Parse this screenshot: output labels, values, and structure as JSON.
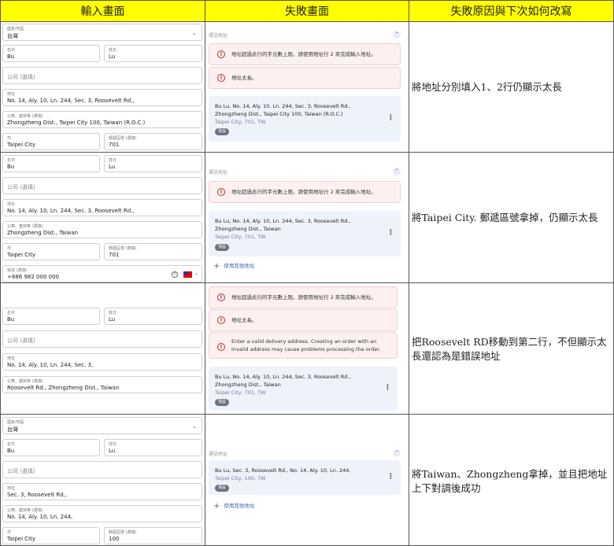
{
  "headers": {
    "input": "輸入畫面",
    "failure": "失敗畫面",
    "reason": "失敗原因與下次如何改寫"
  },
  "labels": {
    "country": "國家/地區",
    "first_name": "名字",
    "last_name": "姓氏",
    "company": "公司 (選填)",
    "address": "地址",
    "apartment": "公寓、套房等 (選填)",
    "city": "市",
    "postal": "郵遞區號 (選填)",
    "phone": "電話 (選填)",
    "shipping": "運送地址",
    "default_badge": "預設",
    "use_other": "使用其他地址",
    "help_icon": "?",
    "up_icon": "⌃",
    "error_icon": "!",
    "kebab_icon": "⋮",
    "chevron_icon": "⌄",
    "plus_icon": "+"
  },
  "errors": {
    "limit": "地址超過此行的字元數上限。請使用地址行 2 來完成輸入地址。",
    "too_long": "地址太長。",
    "invalid": "Enter a valid delivery address. Creating an order with an invalid address may cause problems processing the order."
  },
  "rows": [
    {
      "country": "台灣",
      "first": "Bu",
      "last": "Lu",
      "address": "No. 14, Aly. 10, Ln. 244, Sec. 3, Roosevelt Rd.,",
      "apartment": "Zhongzheng Dist., Taipei City 100, Taiwan (R.O.C.)",
      "city": "Taipei City",
      "postal": "701",
      "card_line1": "Bu Lu, No. 14, Aly. 10, Ln. 244, Sec. 3, Roosevelt Rd.,",
      "card_line2": "Zhongzheng Dist., Taipei City 100, Taiwan (R.O.C.)",
      "card_sub": "Taipei City, 701, TW",
      "note": "將地址分別填入1、2行仍顯示太長"
    },
    {
      "first": "Bu",
      "last": "Lu",
      "address": "No. 14, Aly. 10, Ln. 244, Sec. 3, Roosevelt Rd.,",
      "apartment": "Zhongzheng Dist., Taiwan",
      "city": "Taipei City",
      "postal": "701",
      "phone": "+886 982 000 000",
      "card_line1": "Bu Lu, No. 14, Aly. 10, Ln. 244, Sec. 3, Roosevelt Rd.,",
      "card_line2": "Zhongzheng Dist., Taiwan",
      "card_sub": "Taipei City, 701, TW",
      "note": "將Taipei City. 郵遞區號拿掉，仍顯示太長"
    },
    {
      "first": "Bu",
      "last": "Lu",
      "address": "No. 14, Aly. 10, Ln. 244, Sec. 3,",
      "apartment": "Roosevelt Rd., Zhongzheng Dist., Taiwan",
      "card_line1": "Bu Lu, No. 14, Aly. 10, Ln. 244, Sec. 3, Roosevelt Rd.,",
      "card_line2": "Zhongzheng Dist., Taiwan",
      "card_sub": "Taipei City, 701, TW",
      "note": "把Roosevelt RD移動到第二行，不但顯示太長還認為是錯誤地址"
    },
    {
      "country": "台灣",
      "first": "Bu",
      "last": "Lu",
      "address": "Sec. 3, Roosevelt Rd.,",
      "apartment": "No. 14, Aly. 10, Ln. 244,",
      "city": "Taipei City",
      "postal": "100",
      "card_line1": "Bu Lu, Sec. 3, Roosevelt Rd., No. 14, Aly. 10, Ln. 244,",
      "card_sub": "Taipei City, 100, TW",
      "note": "將Taiwan、Zhongzheng拿掉，並且把地址上下對調後成功"
    }
  ]
}
